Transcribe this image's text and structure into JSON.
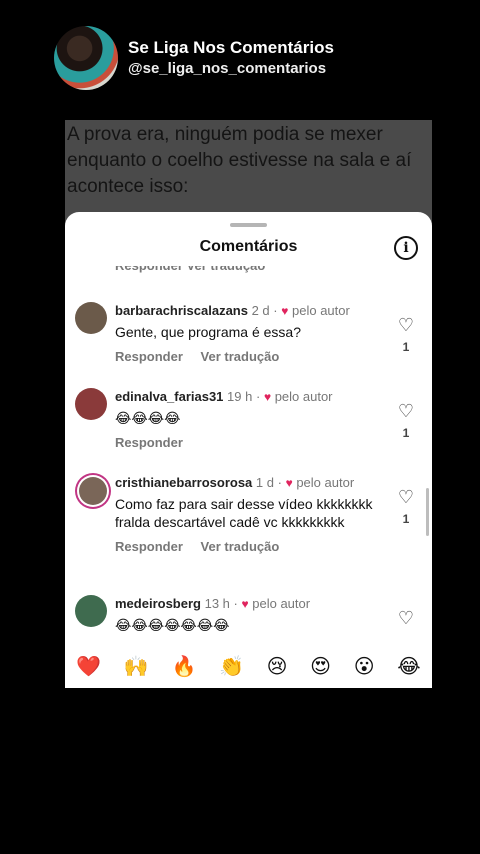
{
  "header": {
    "title": "Se Liga Nos Comentários",
    "handle": "@se_liga_nos_comentarios"
  },
  "background_text": "A prova era, ninguém podia se mexer enquanto o coelho estivesse na sala e aí acontece isso:",
  "sheet": {
    "title": "Comentários",
    "partial_actions": "Responder    Ver tradução"
  },
  "comments": [
    {
      "user": "barbarachriscalazans",
      "time": "2 d",
      "author_label": "pelo autor",
      "text": "Gente, que programa é essa?",
      "reply": "Responder",
      "translate": "Ver tradução",
      "likes": "1",
      "avatar_color": "#6b5a4a"
    },
    {
      "user": "edinalva_farias31",
      "time": "19 h",
      "author_label": "pelo autor",
      "text": "😂😂😂😂",
      "reply": "Responder",
      "likes": "1",
      "avatar_color": "#8a3a3a"
    },
    {
      "user": "cristhianebarrosorosa",
      "time": "1 d",
      "author_label": "pelo autor",
      "text": "Como faz para sair desse vídeo kkkkkkkk fralda descartável cadê vc kkkkkkkkk",
      "reply": "Responder",
      "translate": "Ver tradução",
      "likes": "1",
      "avatar_color": "#7a6658"
    },
    {
      "user": "medeirosberg",
      "time": "13 h",
      "author_label": "pelo autor",
      "text": "😂😂😂😂😂😂😂",
      "avatar_color": "#3f6b4f"
    }
  ],
  "emoji_bar": [
    "❤️",
    "🙌",
    "🔥",
    "👏",
    "😢",
    "😍",
    "😮",
    "😂"
  ],
  "colors": {
    "heart": "#e0245e",
    "sheet_bg": "#ffffff",
    "page_bg": "#000000"
  }
}
